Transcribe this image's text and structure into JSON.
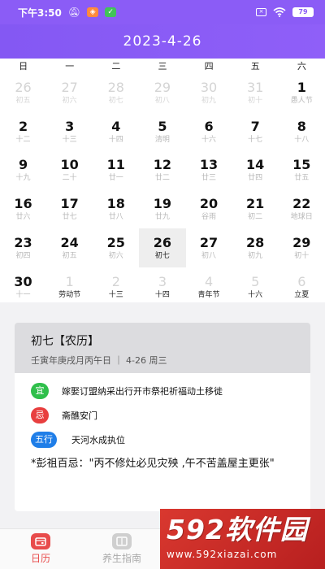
{
  "status": {
    "time": "下午3:50",
    "battery": "79"
  },
  "header": {
    "date": "2023-4-26"
  },
  "weekdays": [
    "日",
    "一",
    "二",
    "三",
    "四",
    "五",
    "六"
  ],
  "days": [
    {
      "n": "26",
      "l": "初五",
      "out": true
    },
    {
      "n": "27",
      "l": "初六",
      "out": true
    },
    {
      "n": "28",
      "l": "初七",
      "out": true
    },
    {
      "n": "29",
      "l": "初八",
      "out": true
    },
    {
      "n": "30",
      "l": "初九",
      "out": true
    },
    {
      "n": "31",
      "l": "初十",
      "out": true
    },
    {
      "n": "1",
      "l": "愚人节"
    },
    {
      "n": "2",
      "l": "十二"
    },
    {
      "n": "3",
      "l": "十三"
    },
    {
      "n": "4",
      "l": "十四"
    },
    {
      "n": "5",
      "l": "清明"
    },
    {
      "n": "6",
      "l": "十六"
    },
    {
      "n": "7",
      "l": "十七"
    },
    {
      "n": "8",
      "l": "十八"
    },
    {
      "n": "9",
      "l": "十九"
    },
    {
      "n": "10",
      "l": "二十"
    },
    {
      "n": "11",
      "l": "廿一"
    },
    {
      "n": "12",
      "l": "廿二"
    },
    {
      "n": "13",
      "l": "廿三"
    },
    {
      "n": "14",
      "l": "廿四"
    },
    {
      "n": "15",
      "l": "廿五"
    },
    {
      "n": "16",
      "l": "廿六"
    },
    {
      "n": "17",
      "l": "廿七"
    },
    {
      "n": "18",
      "l": "廿八"
    },
    {
      "n": "19",
      "l": "廿九"
    },
    {
      "n": "20",
      "l": "谷雨"
    },
    {
      "n": "21",
      "l": "初二"
    },
    {
      "n": "22",
      "l": "地球日"
    },
    {
      "n": "23",
      "l": "初四"
    },
    {
      "n": "24",
      "l": "初五"
    },
    {
      "n": "25",
      "l": "初六"
    },
    {
      "n": "26",
      "l": "初七",
      "sel": true
    },
    {
      "n": "27",
      "l": "初八"
    },
    {
      "n": "28",
      "l": "初九"
    },
    {
      "n": "29",
      "l": "初十"
    },
    {
      "n": "30",
      "l": "十一"
    },
    {
      "n": "1",
      "l": "劳动节",
      "out": true,
      "hl": true
    },
    {
      "n": "2",
      "l": "十三",
      "out": true,
      "hl": true
    },
    {
      "n": "3",
      "l": "十四",
      "out": true,
      "hl": true
    },
    {
      "n": "4",
      "l": "青年节",
      "out": true,
      "hl": true
    },
    {
      "n": "5",
      "l": "十六",
      "out": true,
      "hl": true
    },
    {
      "n": "6",
      "l": "立夏",
      "out": true,
      "hl": true
    }
  ],
  "detail": {
    "title": "初七【农历】",
    "subtitle": "壬寅年庚戌月丙午日 ｜ 4-26 周三",
    "yi_badge": "宜",
    "yi_text": "嫁娶订盟纳采出行开市祭祀祈福动土移徙",
    "ji_badge": "忌",
    "ji_text": "斋醮安门",
    "wuxing_badge": "五行",
    "wuxing_text": "天河水成执位",
    "pengzu": "*彭祖百忌：\"丙不修灶必见灾殃 ,午不苦盖屋主更张\""
  },
  "tabs": [
    {
      "label": "日历",
      "icon": "calendar-icon"
    },
    {
      "label": "养生指南",
      "icon": "guide-icon"
    }
  ],
  "watermark": {
    "big": "592软件园",
    "small": "www.592xiazai.com"
  },
  "colors": {
    "header": "#8b5cf6",
    "yi": "#2fbf4b",
    "ji": "#e83f3f",
    "wuxing": "#1f7ee8",
    "active_tab": "#e84c4c"
  }
}
